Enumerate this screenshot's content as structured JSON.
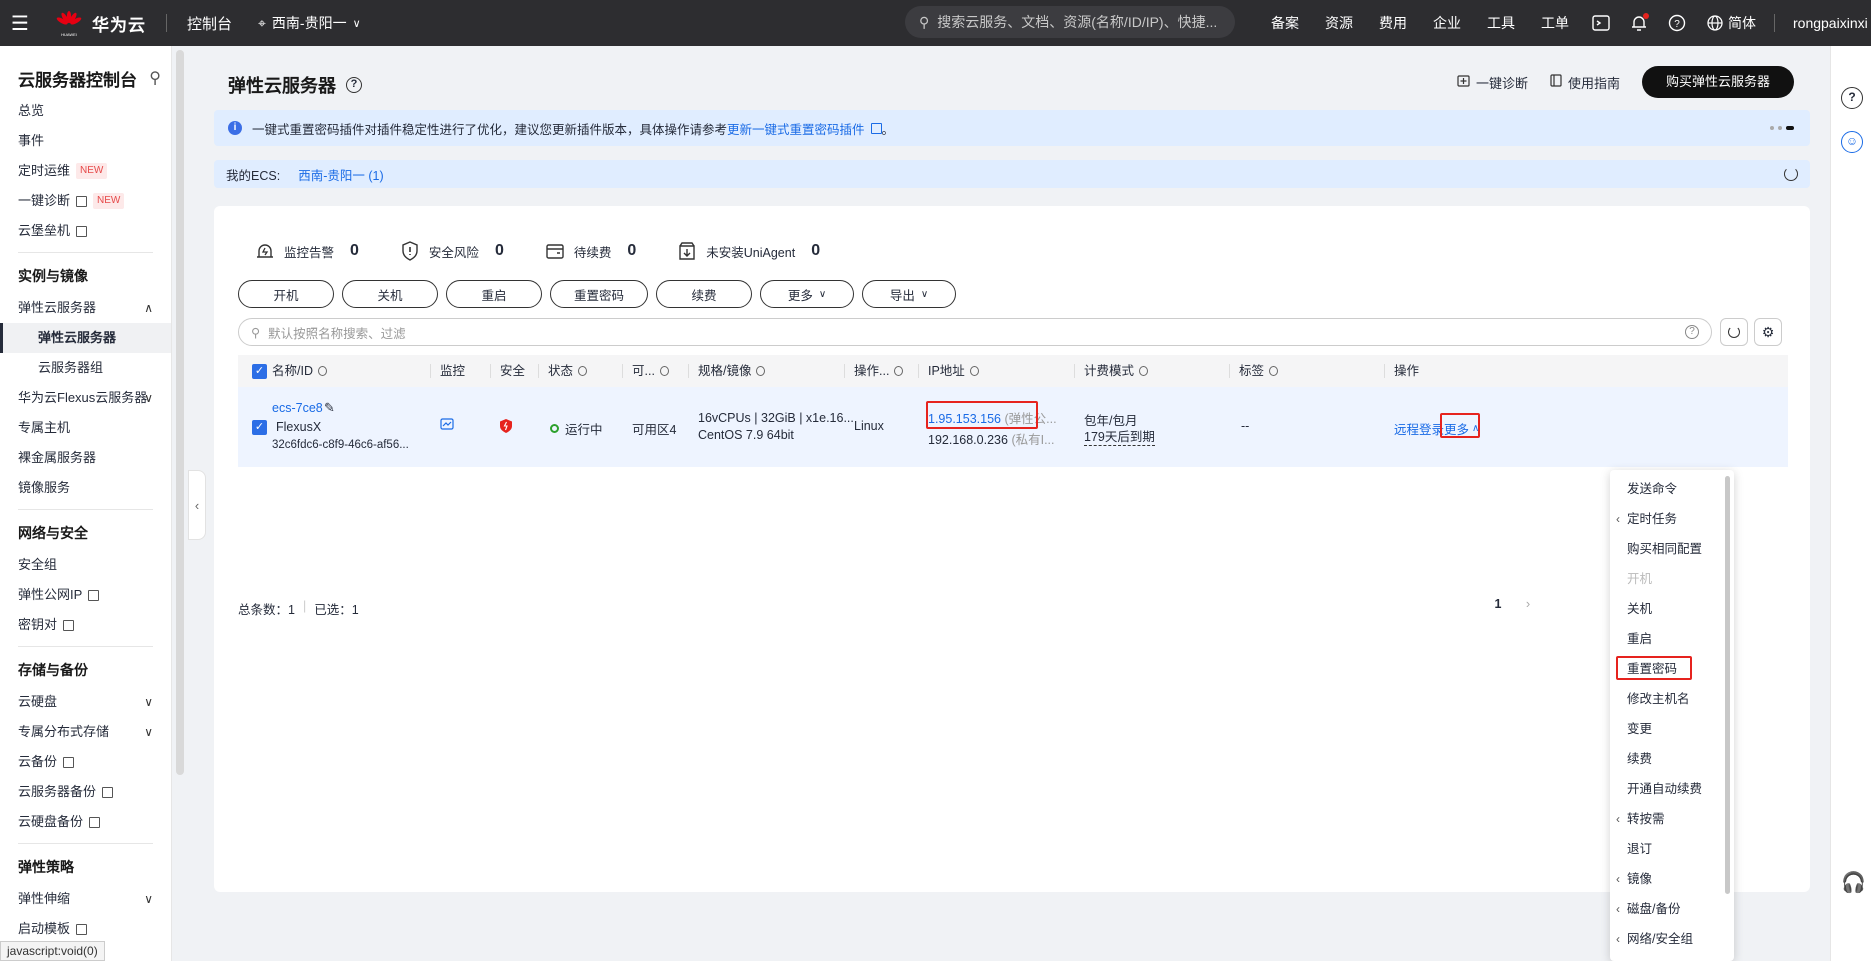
{
  "topbar": {
    "brand": "华为云",
    "brand_sub": "HUAWEI",
    "console": "控制台",
    "region": "西南-贵阳一",
    "search_placeholder": "搜索云服务、文档、资源(名称/ID/IP)、快捷...",
    "links": [
      "备案",
      "资源",
      "费用",
      "企业",
      "工具",
      "工单"
    ],
    "language": "简体",
    "user": "rongpaixinxi"
  },
  "sidebar": {
    "title": "云服务器控制台",
    "top_items": [
      {
        "label": "总览"
      },
      {
        "label": "事件"
      },
      {
        "label": "定时运维",
        "badge": "NEW"
      },
      {
        "label": "一键诊断",
        "badge": "NEW"
      },
      {
        "label": "云堡垒机"
      }
    ],
    "groups": {
      "g1": "实例与镜像",
      "g2": "网络与安全",
      "g3": "存储与备份",
      "g4": "弹性策略"
    },
    "g1_items": [
      "弹性云服务器",
      "弹性云服务器",
      "云服务器组",
      "华为云Flexus云服务器",
      "专属主机",
      "裸金属服务器",
      "镜像服务"
    ],
    "g2_items": [
      "安全组",
      "弹性公网IP",
      "密钥对"
    ],
    "g3_items": [
      "云硬盘",
      "专属分布式存储",
      "云备份",
      "云服务器备份",
      "云硬盘备份"
    ],
    "g4_items": [
      "弹性伸缩",
      "启动模板"
    ]
  },
  "header": {
    "title": "弹性云服务器",
    "diagnose": "一键诊断",
    "guide": "使用指南",
    "buy": "购买弹性云服务器"
  },
  "notice": {
    "text": "一键式重置密码插件对插件稳定性进行了优化，建议您更新插件版本，具体操作请参考",
    "link": "更新一键式重置密码插件",
    "tail": "。"
  },
  "myecs": {
    "label": "我的ECS:",
    "value": "西南-贵阳一 (1)"
  },
  "stats": [
    {
      "label": "监控告警",
      "value": "0"
    },
    {
      "label": "安全风险",
      "value": "0"
    },
    {
      "label": "待续费",
      "value": "0"
    },
    {
      "label": "未安装UniAgent",
      "value": "0"
    }
  ],
  "actions": [
    "开机",
    "关机",
    "重启",
    "重置密码",
    "续费",
    "更多",
    "导出"
  ],
  "search": {
    "placeholder": "默认按照名称搜索、过滤"
  },
  "table": {
    "columns": [
      "名称/ID",
      "监控",
      "安全",
      "状态",
      "可...",
      "规格/镜像",
      "操作...",
      "IP地址",
      "计费模式",
      "标签",
      "操作"
    ],
    "row": {
      "name": "ecs-7ce8",
      "type": "FlexusX",
      "id": "32c6fdc6-c8f9-46c6-af56...",
      "status": "运行中",
      "zone": "可用区4",
      "spec": "16vCPUs | 32GiB | x1e.16...",
      "image": "CentOS 7.9 64bit",
      "os": "Linux",
      "ip_public": "1.95.153.156",
      "ip_public_tag": "(弹性公...",
      "ip_private": "192.168.0.236",
      "ip_private_tag": "(私有I...",
      "billing": "包年/包月",
      "expire": "179天后到期",
      "tags": "--",
      "op_remote": "远程登录",
      "op_more": "更多"
    }
  },
  "footer": {
    "total": "总条数：1",
    "selected": "已选：1",
    "page": "1"
  },
  "dropdown": [
    {
      "label": "发送命令"
    },
    {
      "label": "定时任务",
      "sub": true
    },
    {
      "label": "购买相同配置"
    },
    {
      "label": "开机",
      "disabled": true
    },
    {
      "label": "关机"
    },
    {
      "label": "重启"
    },
    {
      "label": "重置密码",
      "highlight": true
    },
    {
      "label": "修改主机名"
    },
    {
      "label": "变更"
    },
    {
      "label": "续费"
    },
    {
      "label": "开通自动续费"
    },
    {
      "label": "转按需",
      "sub": true
    },
    {
      "label": "退订"
    },
    {
      "label": "镜像",
      "sub": true
    },
    {
      "label": "磁盘/备份",
      "sub": true
    },
    {
      "label": "网络/安全组",
      "sub": true
    }
  ],
  "statusbar": "javascript:void(0)",
  "colors": {
    "topbar": "#2d2d30",
    "link": "#1a6be6",
    "highlight_box": "#e6231e",
    "status_running": "#2ca02c",
    "notice_bg": "#e0edff"
  }
}
